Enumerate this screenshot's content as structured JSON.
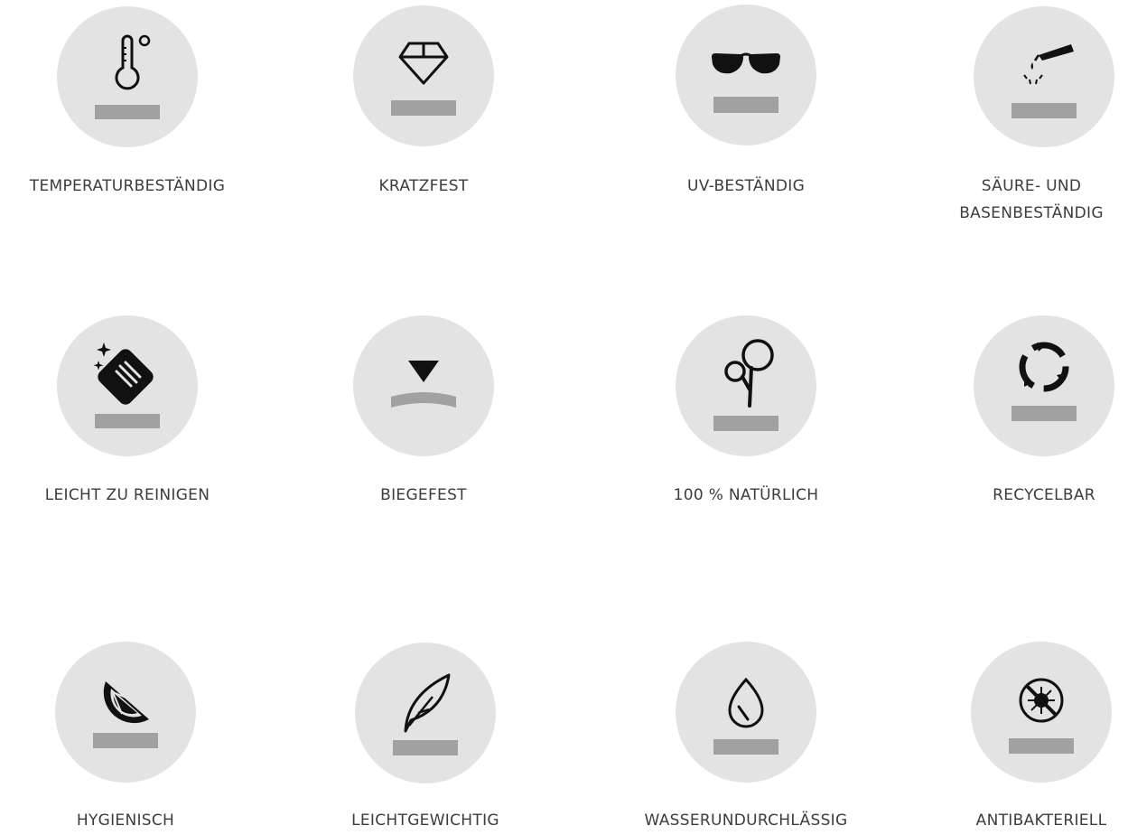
{
  "colors": {
    "circle": "#e3e3e3",
    "icon": "#111111",
    "bar": "#a1a1a1",
    "text": "#3c3c3c"
  },
  "features": [
    {
      "label": "TEMPERATURBESTÄNDIG",
      "icon": "thermometer-icon"
    },
    {
      "label": "KRATZFEST",
      "icon": "diamond-icon"
    },
    {
      "label": "UV-BESTÄNDIG",
      "icon": "sunglasses-icon"
    },
    {
      "label": "SÄURE- UND\nBASENBESTÄNDIG",
      "icon": "acid-drip-icon"
    },
    {
      "label": "LEICHT ZU REINIGEN",
      "icon": "cleaning-cloth-icon"
    },
    {
      "label": "BIEGEFEST",
      "icon": "bend-icon"
    },
    {
      "label": "100 % NATÜRLICH",
      "icon": "tree-icon"
    },
    {
      "label": "RECYCELBAR",
      "icon": "recycle-icon"
    },
    {
      "label": "HYGIENISCH",
      "icon": "citrus-slice-icon"
    },
    {
      "label": "LEICHTGEWICHTIG",
      "icon": "feather-icon"
    },
    {
      "label": "WASSERUNDURCHLÄSSIG",
      "icon": "water-drop-icon"
    },
    {
      "label": "ANTIBAKTERIELL",
      "icon": "no-bacteria-icon"
    }
  ]
}
